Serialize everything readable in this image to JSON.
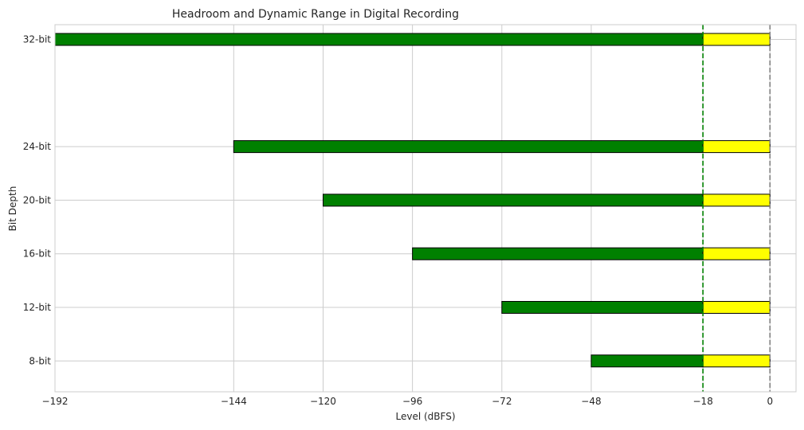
{
  "chart_data": {
    "type": "bar",
    "orientation": "horizontal",
    "stacked": true,
    "title": "Headroom and Dynamic Range in Digital Recording",
    "xlabel": "Level (dBFS)",
    "ylabel": "Bit Depth",
    "xlim": [
      -192,
      7
    ],
    "xticks": [
      -192,
      -144,
      -120,
      -96,
      -72,
      -48,
      -18,
      0
    ],
    "xtick_labels": [
      "−192",
      "−144",
      "−120",
      "−96",
      "−72",
      "−48",
      "−18",
      "0"
    ],
    "grid": true,
    "categories": [
      {
        "label": "8-bit",
        "bit_depth": 8
      },
      {
        "label": "12-bit",
        "bit_depth": 12
      },
      {
        "label": "16-bit",
        "bit_depth": 16
      },
      {
        "label": "20-bit",
        "bit_depth": 20
      },
      {
        "label": "24-bit",
        "bit_depth": 24
      },
      {
        "label": "32-bit",
        "bit_depth": 32
      }
    ],
    "series": [
      {
        "color": "#008000",
        "start": [
          -48,
          -72,
          -96,
          -120,
          -144,
          -192
        ],
        "end": [
          -18,
          -18,
          -18,
          -18,
          -18,
          -18
        ]
      },
      {
        "color": "#ffff00",
        "start": [
          -18,
          -18,
          -18,
          -18,
          -18,
          -18
        ],
        "end": [
          0,
          0,
          0,
          0,
          0,
          0
        ]
      }
    ],
    "reference_lines": [
      {
        "x": -18,
        "color": "#008000",
        "style": "dashed"
      },
      {
        "x": 0,
        "color": "#808080",
        "style": "dashed"
      }
    ]
  }
}
